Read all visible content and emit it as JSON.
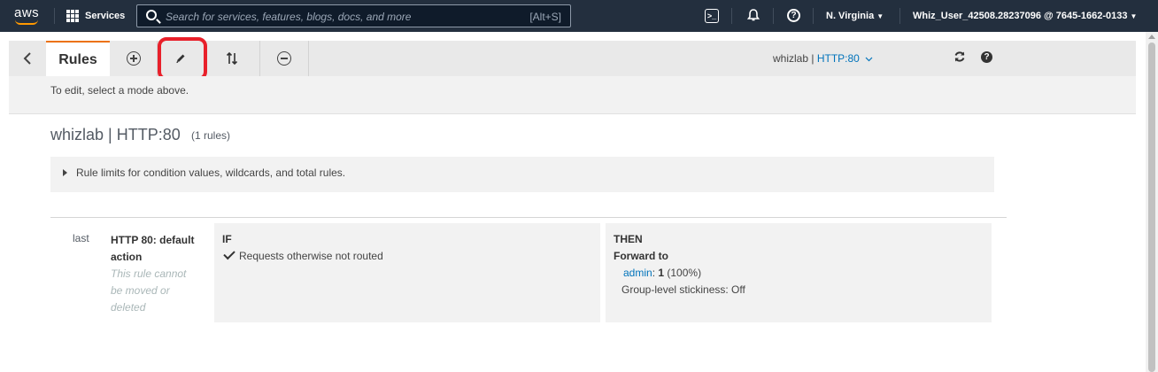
{
  "topnav": {
    "logo_text": "aws",
    "services_label": "Services",
    "search_placeholder": "Search for services, features, blogs, docs, and more",
    "search_shortcut": "[Alt+S]",
    "region": "N. Virginia",
    "account": "Whiz_User_42508.28237096 @ 7645-1662-0133"
  },
  "toolbar": {
    "rules_tab": "Rules",
    "listener_name": "whizlab",
    "listener_sep": " | ",
    "listener_protocol": "HTTP:80",
    "mode_hint": "To edit, select a mode above."
  },
  "page": {
    "title": "whizlab | HTTP:80",
    "rule_count": "(1 rules)",
    "limits_text": "Rule limits for condition values, wildcards, and total rules."
  },
  "rules": [
    {
      "priority": "last",
      "name": "HTTP 80: default action",
      "note": "This rule cannot be moved or deleted",
      "if_label": "IF",
      "condition": "Requests otherwise not routed",
      "then_label": "THEN",
      "action": "Forward to",
      "target_group": "admin",
      "target_sep": ": ",
      "weight": "1",
      "weight_pct": "(100%)",
      "stickiness": "Group-level stickiness: Off"
    }
  ],
  "colors": {
    "nav_bg": "#232f3e",
    "accent": "#ec7211",
    "link": "#0073bb",
    "highlight": "#e8202a"
  }
}
